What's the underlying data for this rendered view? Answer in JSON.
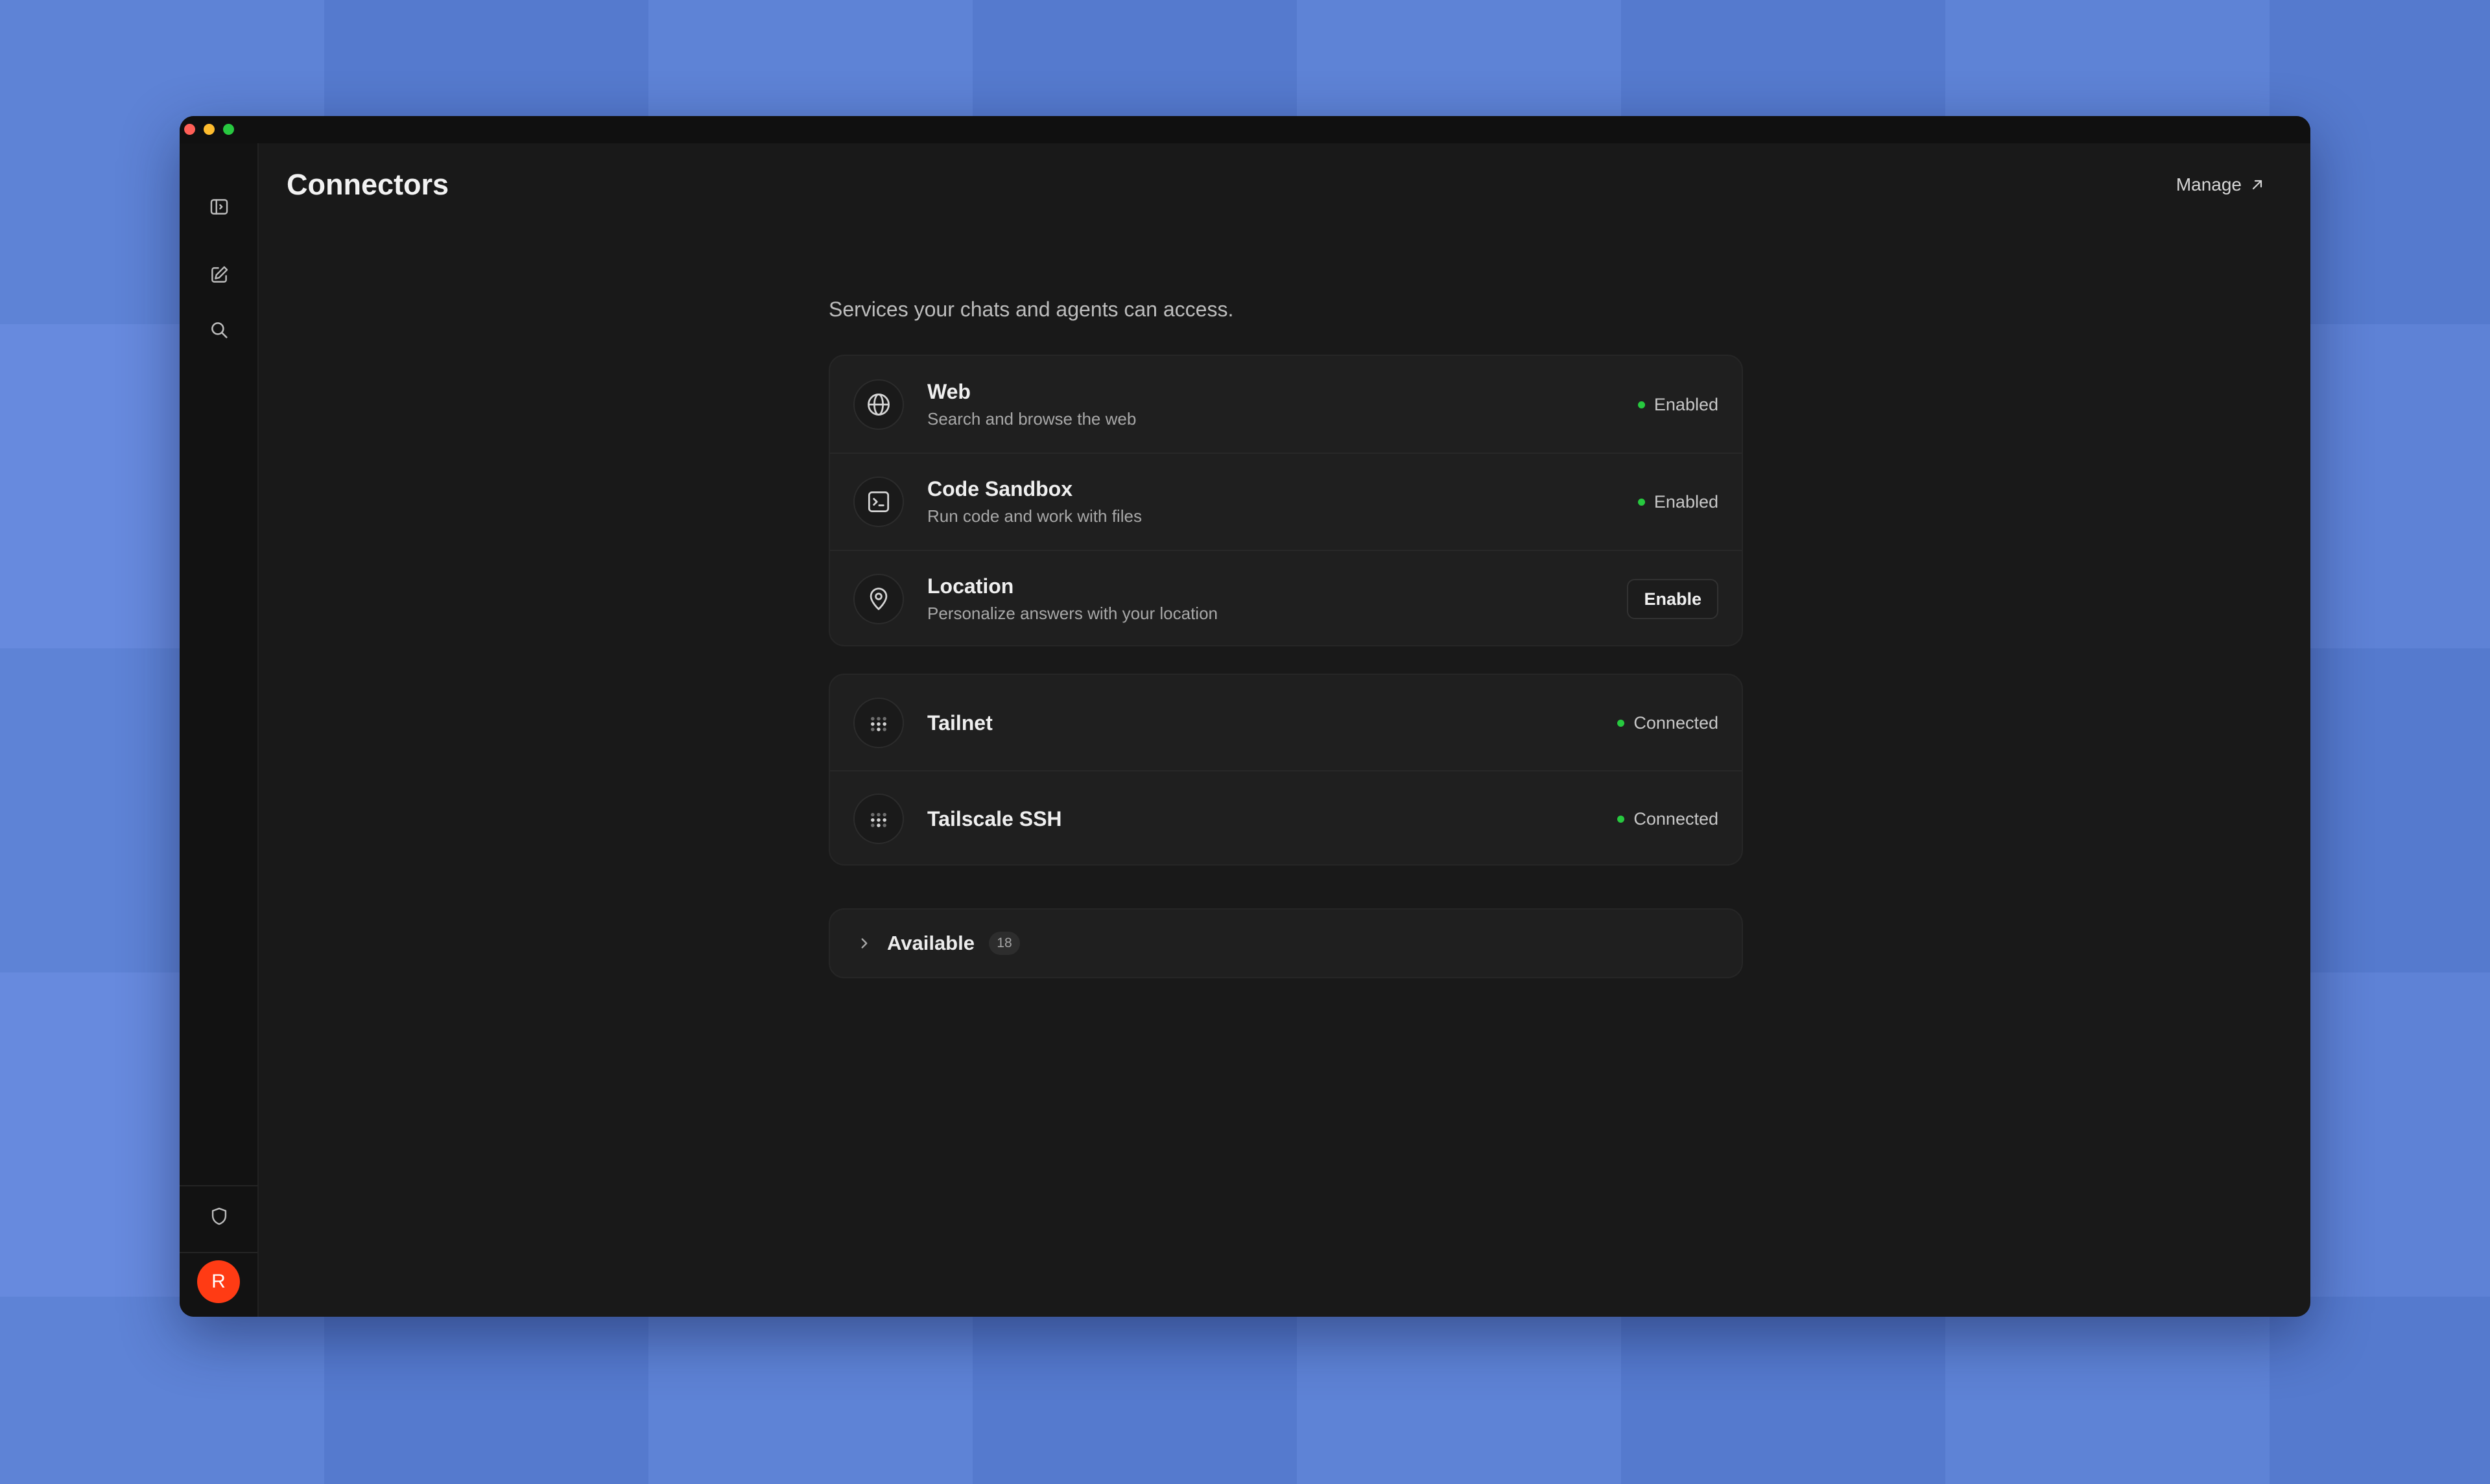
{
  "window": {
    "title": "Connectors",
    "manage_label": "Manage"
  },
  "sidebar": {
    "items": [
      {
        "name": "toggle-sidebar",
        "icon": "sidebar-icon"
      },
      {
        "name": "new-chat",
        "icon": "edit-icon"
      },
      {
        "name": "search",
        "icon": "search-icon"
      },
      {
        "name": "privacy",
        "icon": "shield-icon"
      }
    ],
    "avatar_initial": "R"
  },
  "main": {
    "subtitle": "Services your chats and agents can access.",
    "built_in": [
      {
        "title": "Web",
        "description": "Search and browse the web",
        "status": "Enabled",
        "icon": "globe-icon"
      },
      {
        "title": "Code Sandbox",
        "description": "Run code and work with files",
        "status": "Enabled",
        "icon": "terminal-icon"
      },
      {
        "title": "Location",
        "description": "Personalize answers with your location",
        "action": "Enable",
        "icon": "location-pin-icon"
      }
    ],
    "connected": [
      {
        "title": "Tailnet",
        "status": "Connected",
        "icon": "tailscale-icon"
      },
      {
        "title": "Tailscale SSH",
        "status": "Connected",
        "icon": "tailscale-icon"
      }
    ],
    "available": {
      "label": "Available",
      "count": "18"
    }
  },
  "colors": {
    "status_green": "#27c93f",
    "avatar_bg": "#ff3b14",
    "window_bg": "#191919",
    "desktop_bg": "#5b82dc"
  }
}
